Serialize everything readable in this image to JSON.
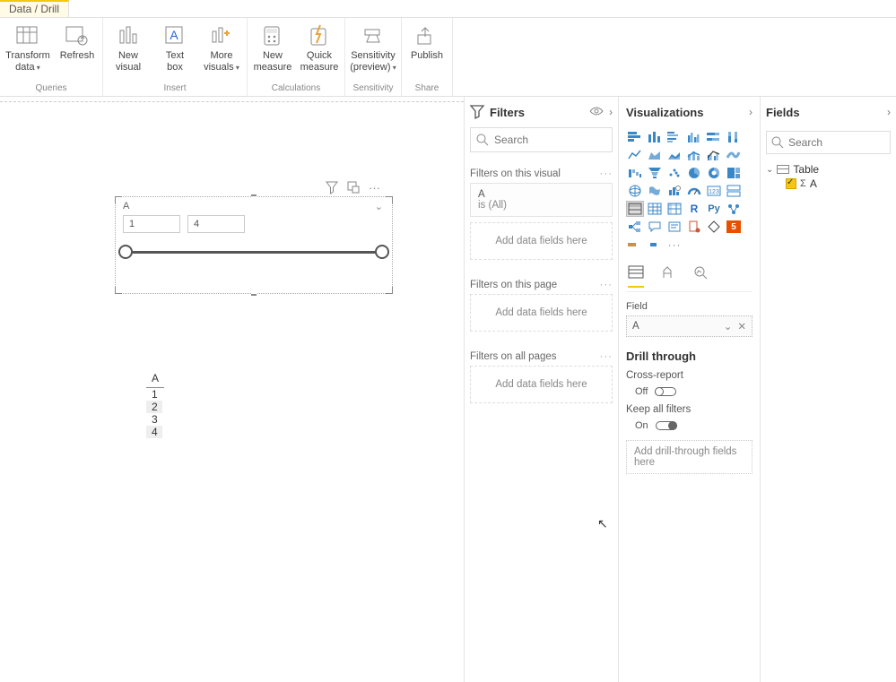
{
  "tab": {
    "active": "Data / Drill"
  },
  "ribbon": {
    "groups": [
      {
        "label": "Queries",
        "items": [
          {
            "label": "Transform\ndata",
            "dd": true
          },
          {
            "label": "Refresh",
            "dd": false
          }
        ]
      },
      {
        "label": "Insert",
        "items": [
          {
            "label": "New\nvisual",
            "dd": false
          },
          {
            "label": "Text\nbox",
            "dd": false
          },
          {
            "label": "More\nvisuals",
            "dd": true
          }
        ]
      },
      {
        "label": "Calculations",
        "items": [
          {
            "label": "New\nmeasure",
            "dd": false
          },
          {
            "label": "Quick\nmeasure",
            "dd": false
          }
        ]
      },
      {
        "label": "Sensitivity",
        "items": [
          {
            "label": "Sensitivity\n(preview)",
            "dd": true
          }
        ]
      },
      {
        "label": "Share",
        "items": [
          {
            "label": "Publish",
            "dd": false
          }
        ]
      }
    ]
  },
  "visual_toolbar": {
    "filter": "filter",
    "focus": "focus",
    "more": "···"
  },
  "slicer": {
    "title": "A",
    "from": "1",
    "to": "4"
  },
  "table": {
    "header": "A",
    "rows": [
      "1",
      "2",
      "3",
      "4"
    ]
  },
  "filters_pane": {
    "title": "Filters",
    "search_placeholder": "Search",
    "sections": {
      "visual": "Filters on this visual",
      "page": "Filters on this page",
      "all": "Filters on all pages"
    },
    "visual_card": {
      "field": "A",
      "summary": "is (All)"
    },
    "drop_text": "Add data fields here"
  },
  "viz_pane": {
    "title": "Visualizations",
    "field_label": "Field",
    "field_value": "A",
    "drill": {
      "title": "Drill through",
      "cross_label": "Cross-report",
      "cross_state": "Off",
      "keep_label": "Keep all filters",
      "keep_state": "On",
      "drop": "Add drill-through fields here"
    }
  },
  "fields_pane": {
    "title": "Fields",
    "search_placeholder": "Search",
    "table_name": "Table",
    "col_name": "A"
  },
  "chart_data": {
    "type": "table",
    "columns": [
      "A"
    ],
    "rows": [
      [
        1
      ],
      [
        2
      ],
      [
        3
      ],
      [
        4
      ]
    ],
    "slicer_range": {
      "field": "A",
      "min": 1,
      "max": 4
    }
  }
}
